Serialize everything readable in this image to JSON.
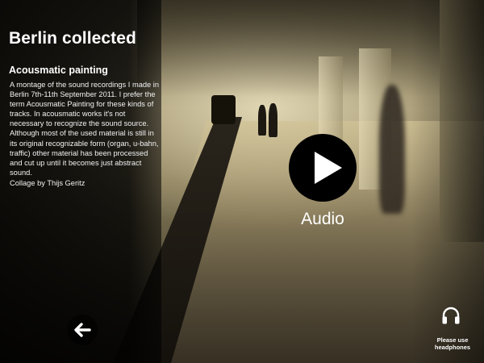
{
  "header": {
    "title": "Berlin collected",
    "subtitle": "Acousmatic painting"
  },
  "content": {
    "description": "A montage of the sound recordings I made in Berlin 7th-11th September 2011. I prefer the term Acousmatic Painting for these kinds of tracks. In acousmatic works it's not necessary to recognize the sound source. Although most of the used material is still in its original recognizable form (organ, u-bahn, traffic) other material has been processed and cut up until it becomes just abstract sound.",
    "credit": "Collage by Thijs Geritz"
  },
  "player": {
    "label": "Audio",
    "icon": "play-icon"
  },
  "navigation": {
    "back_icon": "back-arrow-icon"
  },
  "notice": {
    "icon": "headphones-icon",
    "line1": "Please use",
    "line2": "headphones"
  }
}
